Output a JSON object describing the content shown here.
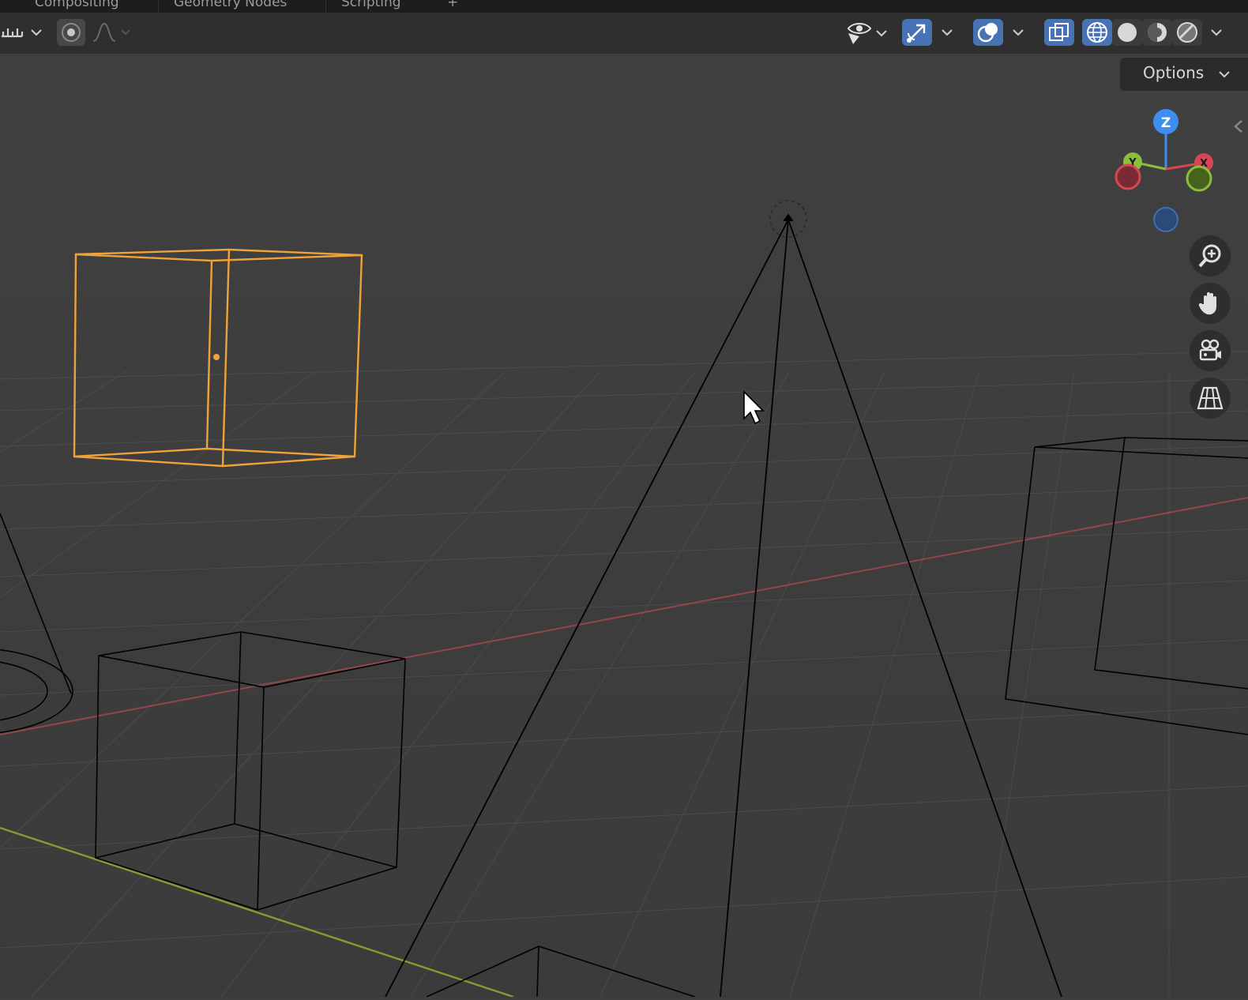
{
  "workspace_tabs": [
    "Compositing",
    "Geometry Nodes",
    "Scripting",
    "+"
  ],
  "header": {
    "snap_icon": "snap-increment-icon",
    "proportional_icon": "proportional-edit-icon",
    "falloff_icon": "falloff-curve-icon",
    "visibility_icon": "eye-selectable-icon",
    "gizmo_icon": "gizmo-arrow-icon",
    "overlay_icon": "overlay-circles-icon",
    "xray_icon": "xray-toggle-icon",
    "shading_modes": [
      "wireframe",
      "solid",
      "material-preview",
      "rendered"
    ],
    "active_shading": "wireframe"
  },
  "options": {
    "label": "Options"
  },
  "nav_gizmo": {
    "axes": [
      "Z",
      "Y",
      "X"
    ],
    "colors": {
      "x": "#d64655",
      "y": "#8bbf3b",
      "z": "#3e8ef0"
    }
  },
  "nav_buttons": [
    "zoom-icon",
    "hand-pan-icon",
    "camera-icon",
    "perspective-grid-icon"
  ],
  "colors": {
    "selection": "#f0a23a",
    "x_axis": "#b2474f",
    "y_axis": "#7f9f30",
    "accent": "#4772b3",
    "wire": "#000000"
  }
}
